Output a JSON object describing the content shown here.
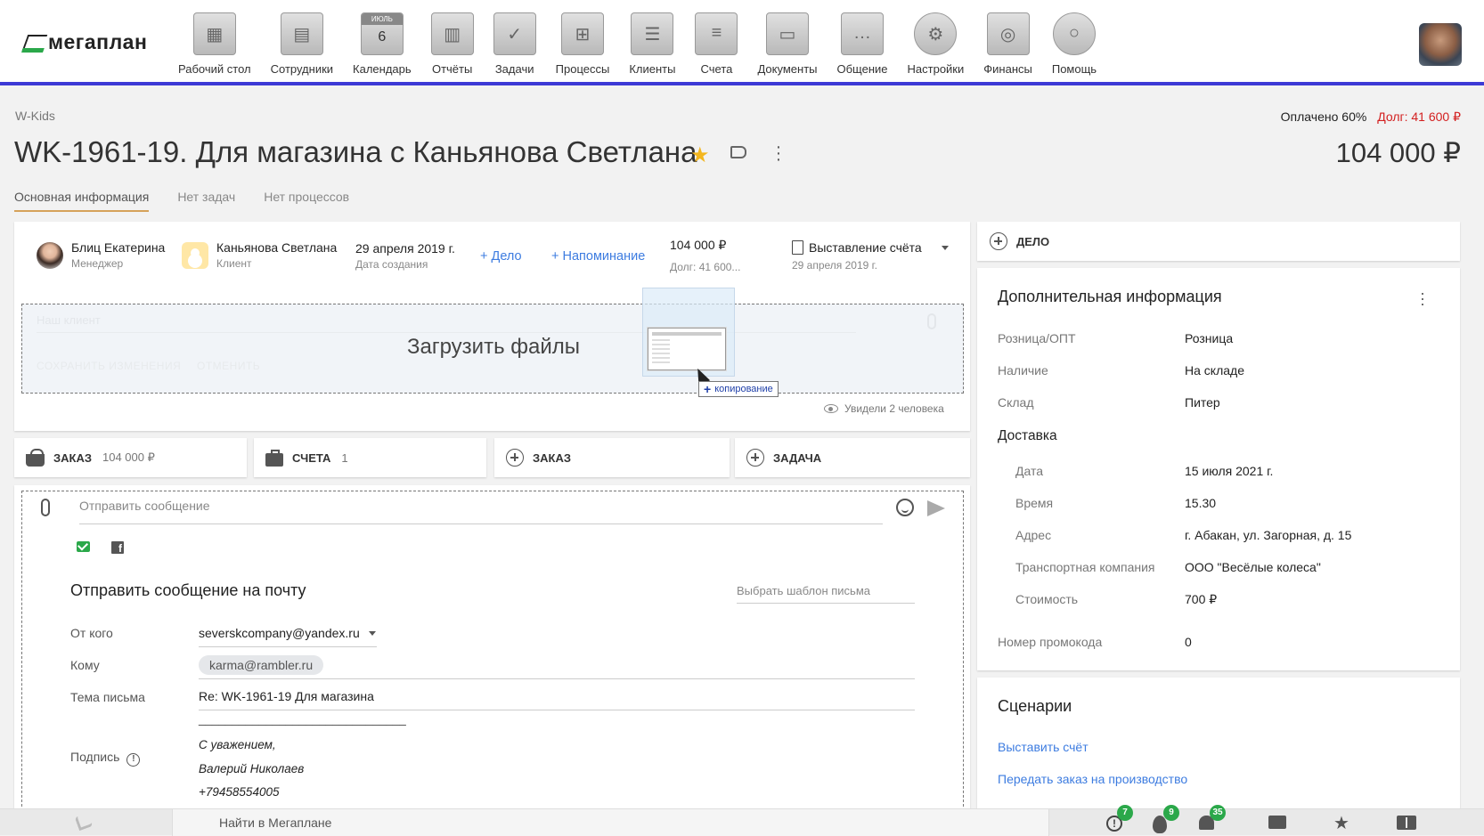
{
  "brand": {
    "name": "мегаплан"
  },
  "nav": [
    {
      "label": "Рабочий стол",
      "icon": "desktop-icon"
    },
    {
      "label": "Сотрудники",
      "icon": "employees-icon"
    },
    {
      "label": "Календарь",
      "icon": "calendar-icon",
      "cal_month": "ИЮЛЬ",
      "cal_day": "6"
    },
    {
      "label": "Отчёты",
      "icon": "reports-icon"
    },
    {
      "label": "Задачи",
      "icon": "tasks-icon"
    },
    {
      "label": "Процессы",
      "icon": "processes-icon"
    },
    {
      "label": "Клиенты",
      "icon": "clients-icon"
    },
    {
      "label": "Счета",
      "icon": "invoices-icon"
    },
    {
      "label": "Документы",
      "icon": "documents-icon"
    },
    {
      "label": "Общение",
      "icon": "communication-icon"
    },
    {
      "label": "Настройки",
      "icon": "settings-icon"
    },
    {
      "label": "Финансы",
      "icon": "finance-icon"
    },
    {
      "label": "Помощь",
      "icon": "help-icon"
    }
  ],
  "header": {
    "breadcrumb": "W-Kids",
    "paid": "Оплачено 60%",
    "debt": "Долг: 41 600 ₽",
    "title": "WK-1961-19. Для магазина с Каньянова Светлана",
    "amount": "104 000 ₽"
  },
  "tabs": [
    {
      "label": "Основная информация",
      "active": true
    },
    {
      "label": "Нет задач",
      "active": false
    },
    {
      "label": "Нет процессов",
      "active": false
    }
  ],
  "deal": {
    "manager": {
      "name": "Блиц Екатерина",
      "role": "Менеджер"
    },
    "client": {
      "name": "Каньянова Светлана",
      "role": "Клиент"
    },
    "created": {
      "date": "29 апреля 2019 г.",
      "label": "Дата создания"
    },
    "add_case": "+ Дело",
    "add_reminder": "+ Напоминание",
    "sum": "104 000 ₽",
    "debt_short": "Долг: 41 600...",
    "status": "Выставление счёта",
    "status_date": "29 апреля 2019 г."
  },
  "dropzone": {
    "ghost_placeholder": "Наш клиент",
    "ghost_save": "СОХРАНИТЬ ИЗМЕНЕНИЯ",
    "ghost_cancel": "ОТМЕНИТЬ",
    "text": "Загрузить файлы",
    "copy_tooltip": "копирование",
    "copy_plus": "+"
  },
  "seen": "Увидели 2 человека",
  "actions": [
    {
      "label": "ЗАКАЗ",
      "count": "104 000 ₽"
    },
    {
      "label": "СЧЕТА",
      "count": "1"
    },
    {
      "label": "ЗАКАЗ",
      "count": ""
    },
    {
      "label": "ЗАДАЧА",
      "count": ""
    }
  ],
  "message": {
    "placeholder": "Отправить сообщение",
    "fb_letter": "f",
    "email_title": "Отправить сообщение на почту",
    "template_placeholder": "Выбрать шаблон письма",
    "from_label": "От кого",
    "from_value": "severskcompany@yandex.ru",
    "to_label": "Кому",
    "to_value": "karma@rambler.ru",
    "subject_label": "Тема письма",
    "subject_value": "Re: WK-1961-19 Для магазина",
    "signature_label": "Подпись",
    "info_glyph": "!",
    "signature_lines": [
      "_______________________________",
      "С уважением,",
      "Валерий Николаев",
      "+79458554005"
    ]
  },
  "right": {
    "delo_label": "ДЕЛО",
    "add_title": "Дополнительная информация",
    "rows": [
      {
        "label": "Розница/ОПТ",
        "value": "Розница"
      },
      {
        "label": "Наличие",
        "value": "На складе"
      },
      {
        "label": "Склад",
        "value": "Питер"
      }
    ],
    "delivery_title": "Доставка",
    "delivery_rows": [
      {
        "label": "Дата",
        "value": "15 июля 2021 г."
      },
      {
        "label": "Время",
        "value": "15.30"
      },
      {
        "label": "Адрес",
        "value": "г. Абакан, ул. Загорная, д. 15"
      },
      {
        "label": "Транспортная компания",
        "value": "ООО \"Весёлые колеса\""
      },
      {
        "label": "Стоимость",
        "value": "700 ₽"
      }
    ],
    "promo_label": "Номер промокода",
    "promo_value": "0",
    "scenarios_title": "Сценарии",
    "scenarios": [
      "Выставить счёт",
      "Передать заказ на производство"
    ]
  },
  "bottom": {
    "search": "Найти в Мегаплане",
    "badges": {
      "warnings": "7",
      "fire": "9",
      "notifications": "35"
    },
    "star_glyph": "★"
  },
  "colors": {
    "accent": "#3d3ad6",
    "link": "#3d7ce0",
    "debt": "#d32020",
    "badge": "#2ba84a",
    "star": "#f3b61f"
  }
}
